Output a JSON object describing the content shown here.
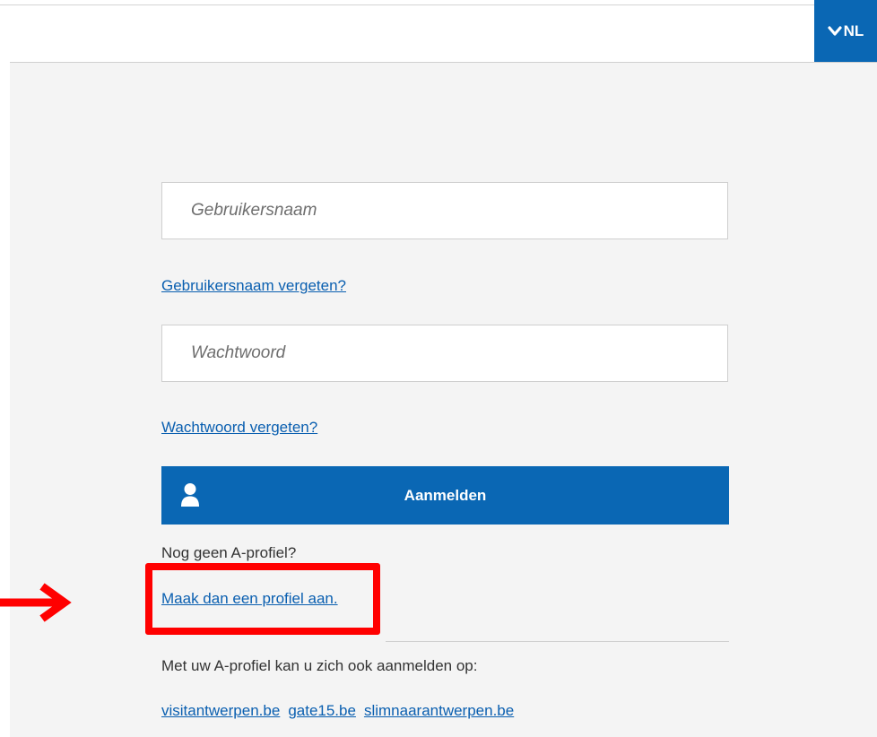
{
  "header": {
    "language_label": "NL",
    "language_icon": "chevron-down-icon"
  },
  "login_form": {
    "username_placeholder": "Gebruikersnaam",
    "forgot_username_label": "Gebruikersnaam vergeten?",
    "password_placeholder": "Wachtwoord",
    "forgot_password_label": "Wachtwoord vergeten?",
    "login_button_label": "Aanmelden",
    "login_button_icon": "user-icon"
  },
  "register": {
    "no_profile_text": "Nog geen A-profiel?",
    "create_profile_label": "Maak dan een profiel aan."
  },
  "other_sites": {
    "intro_text": "Met uw A-profiel kan u zich ook aanmelden op:",
    "links": [
      "visitantwerpen.be",
      "gate15.be",
      "slimnaarantwerpen.be"
    ]
  },
  "annotation": {
    "highlight_color": "#ff0000",
    "arrow_icon": "right-arrow-icon"
  },
  "colors": {
    "brand_blue": "#0a67b4",
    "link_blue": "#0a5fb0",
    "background": "#f4f4f4"
  }
}
